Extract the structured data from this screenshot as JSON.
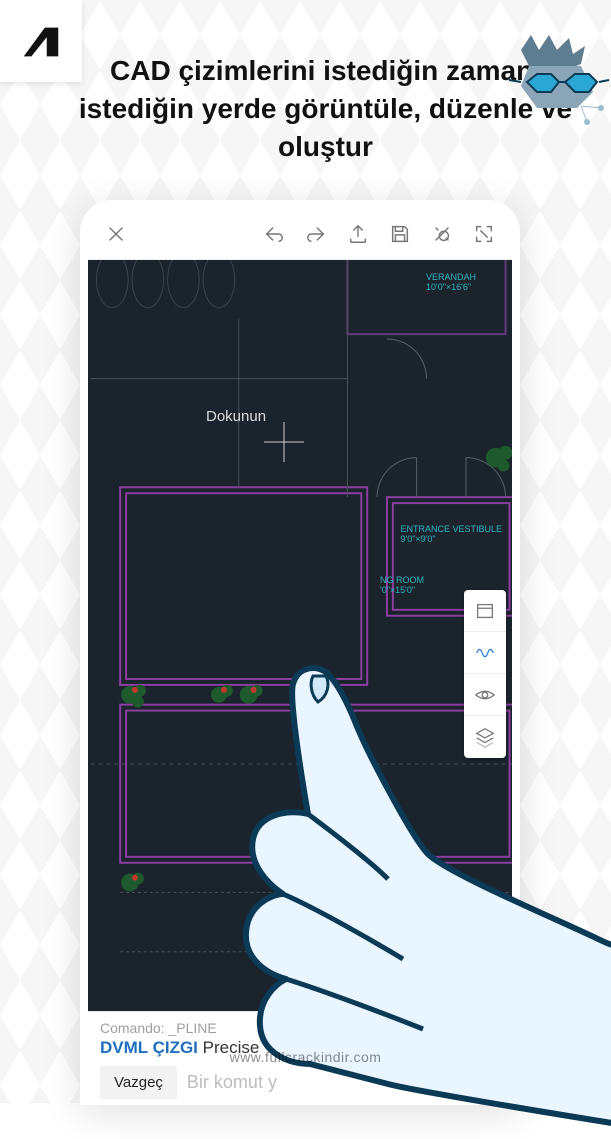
{
  "headline": "CAD çizimlerini istediğin zaman, istediğin yerde görüntüle, düzenle ve oluştur",
  "canvas": {
    "touch_hint": "Dokunun",
    "rooms": {
      "verandah": {
        "name": "VERANDAH",
        "dims": "10'0\"×16'6\""
      },
      "entrance": {
        "name": "ENTRANCE VESTIBULE",
        "dims": "9'0\"×9'0\""
      },
      "living": {
        "name": "NG ROOM",
        "dims": "'0\"×15'0\""
      }
    }
  },
  "command_bar": {
    "history": "Comando: _PLINE",
    "current_keyword": "DVML ÇIZGI",
    "current_rest": " Precise",
    "cancel_label": "Vazgeç",
    "input_placeholder": "Bir komut y"
  },
  "watermark": "www.fullcrackindir.com",
  "toolbar_icons": [
    "close",
    "undo",
    "redo",
    "upload",
    "save",
    "measure",
    "fullscreen"
  ],
  "palette_icons": [
    "window",
    "waveform",
    "visibility",
    "layers"
  ]
}
